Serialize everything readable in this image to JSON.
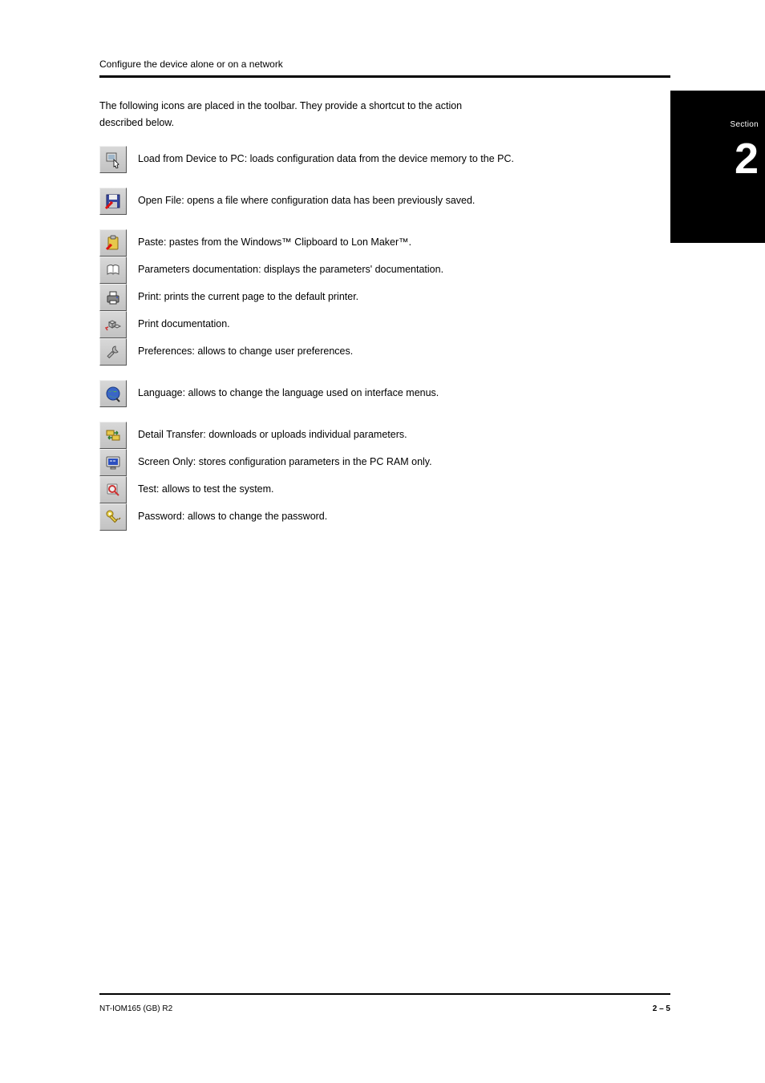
{
  "header": {
    "breadcrumb": "Configure the device alone or on a network",
    "section_label": "Section",
    "section_number": "2"
  },
  "intro": {
    "line1": "The following icons are placed in the toolbar. They provide a shortcut to the action",
    "line2": "described below."
  },
  "rows": [
    {
      "icon": "cursor-to-device-icon",
      "svg": "cursor_device",
      "label": "Load from Device to PC: loads configuration data from the device memory to the PC.",
      "spaced": true
    },
    {
      "icon": "save-disk-icon",
      "svg": "disk_red",
      "label": "Open File: opens a file where configuration data has been previously saved.",
      "spaced": true
    },
    {
      "icon": "clipboard-icon",
      "svg": "clipboard",
      "label": "Paste: pastes from the Windows™ Clipboard to Lon Maker™.",
      "spaced": true
    },
    {
      "icon": "open-book-icon",
      "svg": "book",
      "label": "Parameters documentation: displays the parameters' documentation.",
      "spaced": false
    },
    {
      "icon": "print-icon",
      "svg": "print",
      "label": "Print: prints the current page to the default printer.",
      "spaced": false
    },
    {
      "icon": "cubes-icon",
      "svg": "cubes",
      "label": "Print documentation.",
      "spaced": false
    },
    {
      "icon": "wrench-icon",
      "svg": "wrench",
      "label": "Preferences: allows to change user preferences.",
      "spaced": false
    },
    {
      "icon": "globe-icon",
      "svg": "globe",
      "label": "Language: allows to change the language used on interface menus.",
      "spaced": true
    },
    {
      "icon": "folders-icon",
      "svg": "folders",
      "label": "Detail Transfer: downloads or uploads individual parameters.",
      "spaced": true
    },
    {
      "icon": "monitor-icon",
      "svg": "monitor",
      "label": "Screen Only: stores configuration parameters in the PC RAM only.",
      "spaced": false
    },
    {
      "icon": "magnify-icon",
      "svg": "magnify",
      "label": "Test: allows to test the system.",
      "spaced": false
    },
    {
      "icon": "key-icon",
      "svg": "key",
      "label": "Password: allows to change the password.",
      "spaced": false
    }
  ],
  "footer": {
    "left": "NT-IOM165 (GB) R2",
    "right": "2 – 5"
  }
}
